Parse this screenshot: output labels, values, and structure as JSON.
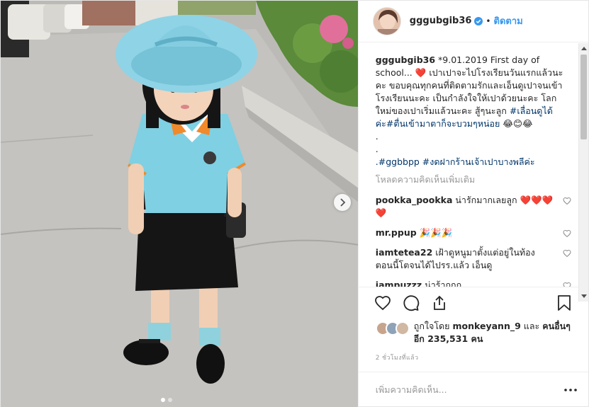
{
  "post": {
    "username": "gggubgib36",
    "follow_label": "ติดตาม",
    "separator": "•",
    "caption": {
      "date_text": "*9.01.2019 First day of school...",
      "heart": "❤️",
      "body": "เปาเปาจะไปโรงเรียนวันแรกแล้วนะคะ ขอบคุณทุกคนที่ติดตามรักและเอ็นดูเปาจนเข้าโรงเรียนนะคะ เป็นกำลังใจให้เปาด้วยนะคะ โลกใหม่ของเปาเริ่มแล้วนะคะ สู้ๆนะลูก",
      "hashtags_line1": "#เลื่อนดูได้ค่ะ#ตื่นเข้ามาตาก็จะบวมๆหน่อย",
      "emojis": "😂😊😂",
      "dot1": ".",
      "dot2": ".",
      "hashtags_line2": ".#ggbbpp #งดฝากร้านเจ้าเปาบางพลีค่ะ"
    },
    "load_more_comments": "โหลดความคิดเห็นเพิ่มเติม",
    "comments": [
      {
        "user": "pookka_pookka",
        "text": "น่ารักมากเลยลูก ❤️❤️❤️❤️"
      },
      {
        "user": "mr.ppup",
        "text": "🎉🎉🎉"
      },
      {
        "user": "iamtetea22",
        "text": "เฝ้าดูหนูมาตั้งแต่อยู่ในท้อง ตอนนี้โตจนได้ไปรร.แล้ว เอ็นดู"
      },
      {
        "user": "iampuzzz",
        "text": "น่าร้ากกก"
      }
    ],
    "likes": {
      "prefix": "ถูกใจโดย",
      "user": "monkeyann_9",
      "and": "และ",
      "others": "คนอื่นๆ อีก 235,531 คน"
    },
    "time_ago": "2 ชั่วโมงที่แล้ว",
    "add_comment_placeholder": "เพิ่มความคิดเห็น..."
  },
  "icons": {
    "verified": "verified-badge-icon",
    "heart": "heart-icon",
    "comment": "comment-icon",
    "share": "share-icon",
    "save": "bookmark-icon",
    "next": "chevron-right-icon",
    "more": "more-options-icon"
  },
  "colors": {
    "link_blue": "#3897f0",
    "hashtag": "#003569",
    "muted": "#999999",
    "text": "#262626",
    "verified": "#3897f0",
    "heart_red": "#ed4956"
  }
}
